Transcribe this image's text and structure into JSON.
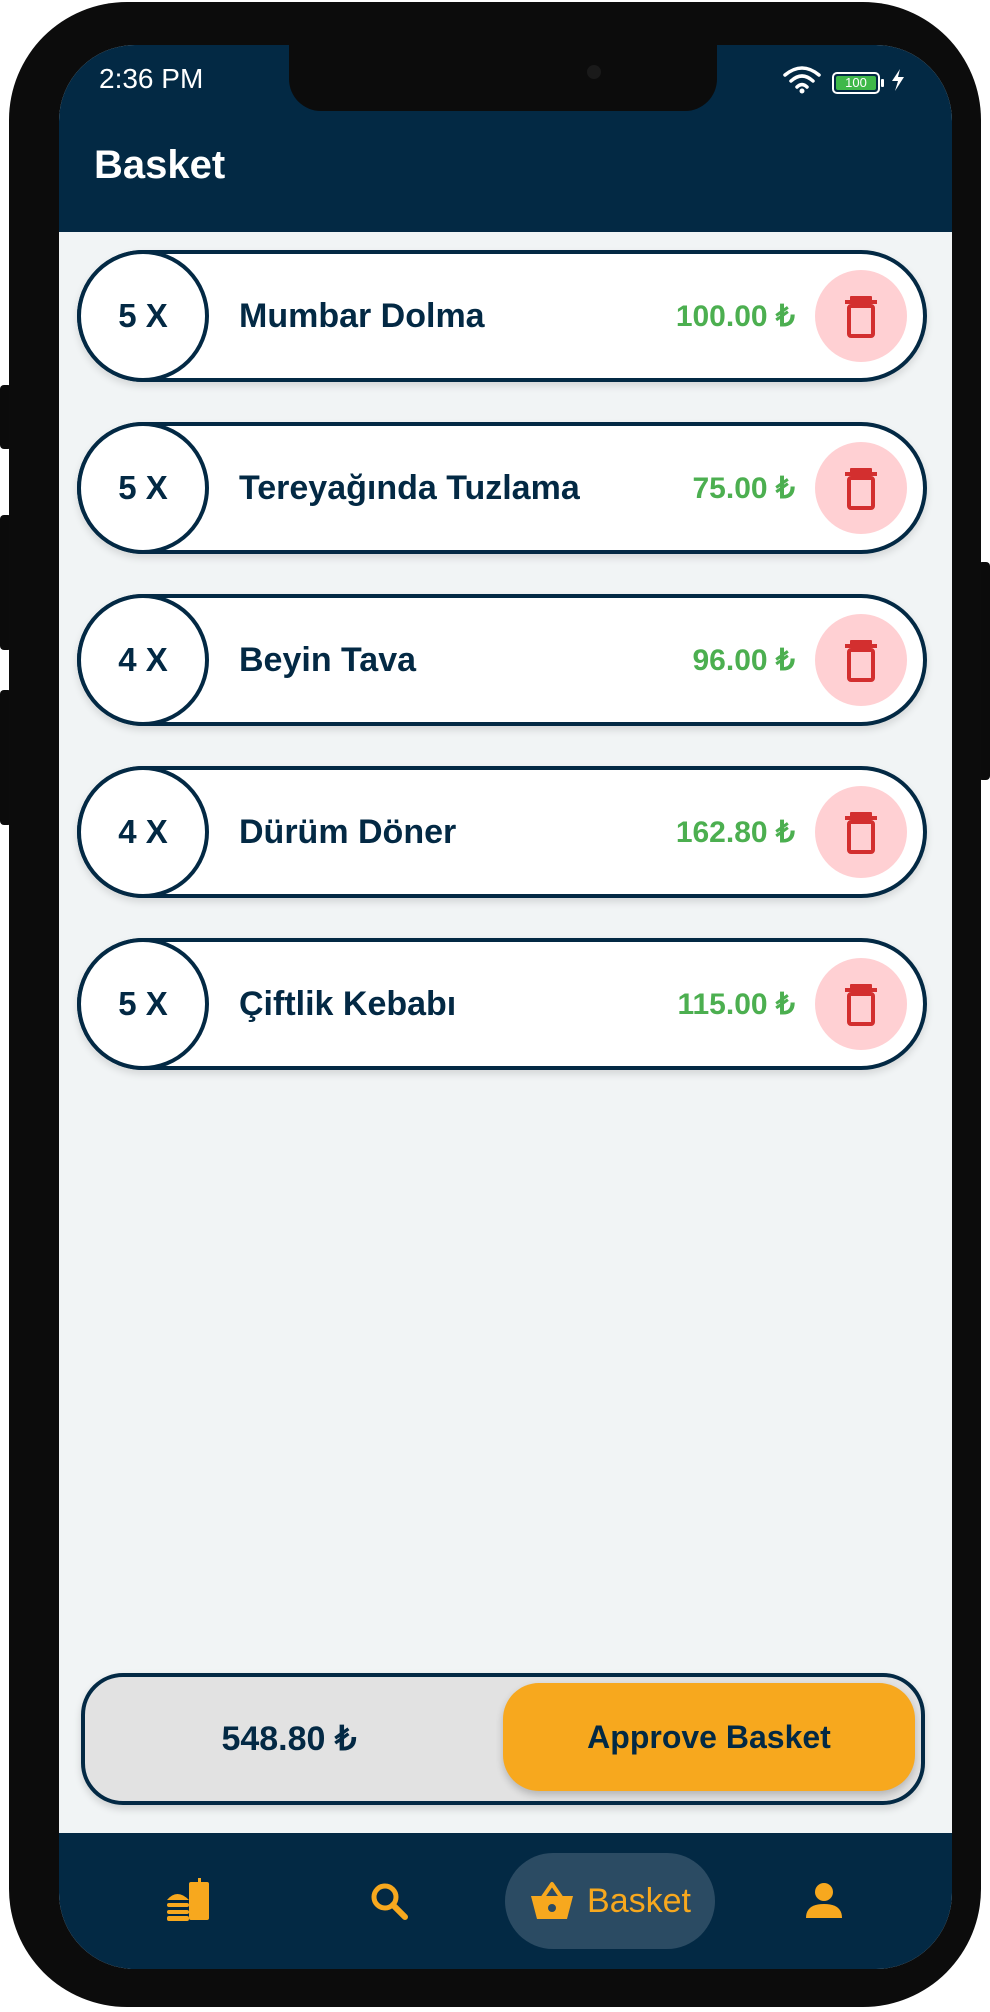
{
  "status_bar": {
    "time": "2:36 PM",
    "battery": "100"
  },
  "header": {
    "title": "Basket"
  },
  "basket": {
    "items": [
      {
        "qty": "5 X",
        "name": "Mumbar Dolma",
        "price": "100.00 ₺"
      },
      {
        "qty": "5 X",
        "name": "Tereyağında Tuzlama",
        "price": "75.00 ₺"
      },
      {
        "qty": "4 X",
        "name": "Beyin Tava",
        "price": "96.00 ₺"
      },
      {
        "qty": "4 X",
        "name": "Dürüm Döner",
        "price": "162.80 ₺"
      },
      {
        "qty": "5 X",
        "name": "Çiftlik Kebabı",
        "price": "115.00 ₺"
      }
    ],
    "total": "548.80 ₺",
    "approve_label": "Approve Basket"
  },
  "bottom_nav": {
    "items": [
      {
        "icon": "food-menu-icon",
        "label": ""
      },
      {
        "icon": "search-icon",
        "label": ""
      },
      {
        "icon": "basket-icon",
        "label": "Basket"
      },
      {
        "icon": "profile-icon",
        "label": ""
      }
    ]
  },
  "colors": {
    "primary": "#032944",
    "accent": "#f7a81e",
    "price": "#4caf50",
    "delete_bg": "#ffd0d3",
    "delete_icon": "#d32f2f",
    "background": "#f1f4f5"
  }
}
